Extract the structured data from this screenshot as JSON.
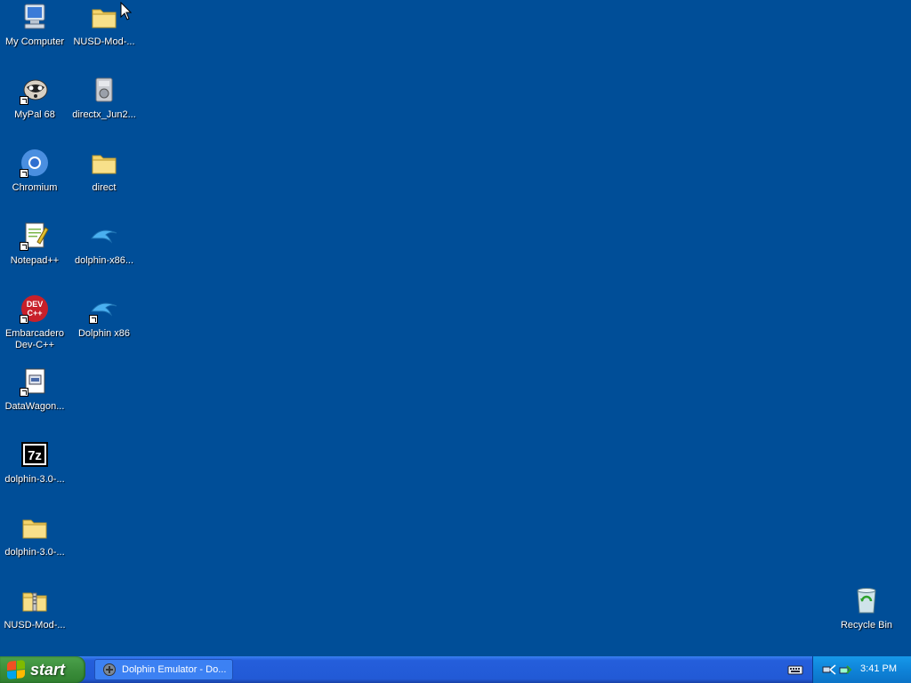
{
  "desktop": {
    "icons": [
      {
        "label": "My Computer",
        "icon": "computer-icon"
      },
      {
        "label": "NUSD-Mod-...",
        "icon": "folder-icon"
      },
      {
        "label": "MyPal 68",
        "icon": "raccoon-icon"
      },
      {
        "label": "directx_Jun2...",
        "icon": "installer-icon"
      },
      {
        "label": "Chromium",
        "icon": "chromium-icon"
      },
      {
        "label": "direct",
        "icon": "folder-icon"
      },
      {
        "label": "Notepad++",
        "icon": "notepadpp-icon"
      },
      {
        "label": "dolphin-x86...",
        "icon": "dolphin-icon"
      },
      {
        "label": "Embarcadero Dev-C++",
        "icon": "devcpp-icon"
      },
      {
        "label": "Dolphin x86",
        "icon": "dolphin-icon"
      },
      {
        "label": "DataWagon...",
        "icon": "datawagon-icon"
      },
      {
        "label": "dolphin-3.0-...",
        "icon": "7zip-icon"
      },
      {
        "label": "dolphin-3.0-...",
        "icon": "folder-icon"
      },
      {
        "label": "NUSD-Mod-...",
        "icon": "zip-folder-icon"
      },
      {
        "label": "Recycle Bin",
        "icon": "recycle-bin-icon"
      }
    ]
  },
  "taskbar": {
    "start_label": "start",
    "task_label": "Dolphin Emulator - Do...",
    "clock": "3:41 PM"
  }
}
